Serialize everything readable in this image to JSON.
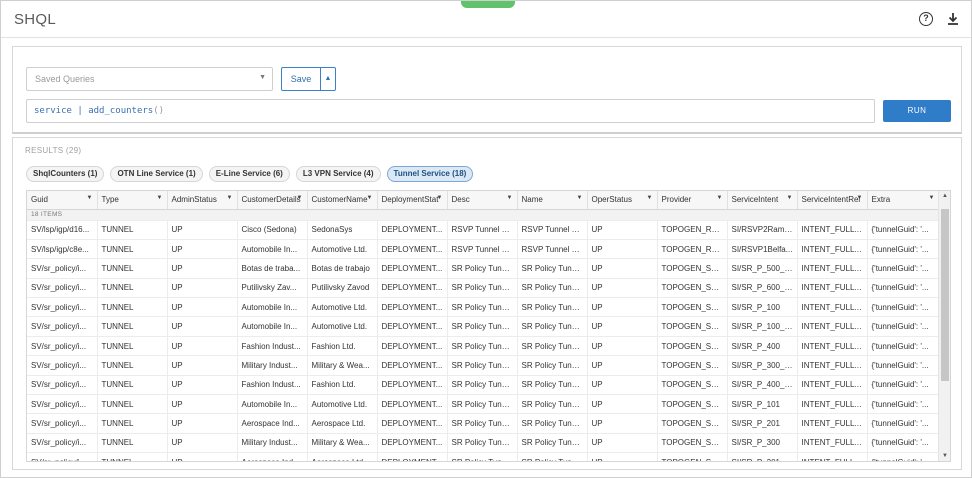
{
  "header": {
    "title": "SHQL"
  },
  "query": {
    "saved_placeholder": "Saved Queries",
    "save_label": "Save",
    "keyword": "service",
    "pipe": "|",
    "func": "add_counters",
    "parens": "()",
    "run_label": "RUN"
  },
  "results": {
    "label": "RESULTS (29)",
    "count_label": "18 ITEMS",
    "tabs": [
      {
        "label": "ShqlCounters (1)"
      },
      {
        "label": "OTN Line Service (1)"
      },
      {
        "label": "E-Line Service (6)"
      },
      {
        "label": "L3 VPN Service (4)"
      },
      {
        "label": "Tunnel Service (18)"
      }
    ],
    "columns": [
      "Guid",
      "Type",
      "AdminStatus",
      "CustomerDetails",
      "CustomerName",
      "DeploymentStat",
      "Desc",
      "Name",
      "OperStatus",
      "Provider",
      "ServiceIntent",
      "ServiceIntentRel",
      "Extra"
    ],
    "rows": [
      [
        "SV/lsp/igp/d16...",
        "TUNNEL",
        "UP",
        "Cisco (Sedona)",
        "SedonaSys",
        "DEPLOYMENT...",
        "RSVP Tunnel <...",
        "RSVP Tunnel <...",
        "UP",
        "TOPOGEN_RS...",
        "SI/RSVP2Rama...",
        "INTENT_FULLY...",
        "{'tunnelGuid': '..."
      ],
      [
        "SV/lsp/igp/c8e...",
        "TUNNEL",
        "UP",
        "Automobile In...",
        "Automotive Ltd.",
        "DEPLOYMENT...",
        "RSVP Tunnel <...",
        "RSVP Tunnel <...",
        "UP",
        "TOPOGEN_RS...",
        "SI/RSVP1Belfa...",
        "INTENT_FULLY...",
        "{'tunnelGuid': '..."
      ],
      [
        "SV/sr_policy/i...",
        "TUNNEL",
        "UP",
        "Botas de traba...",
        "Botas de trabajo",
        "DEPLOYMENT...",
        "SR Policy Tunn...",
        "SR Policy Tunn...",
        "UP",
        "TOPOGEN_SR...",
        "SI/SR_P_500_r...",
        "INTENT_FULLY...",
        "{'tunnelGuid': '..."
      ],
      [
        "SV/sr_policy/i...",
        "TUNNEL",
        "UP",
        "Putilivsky Zav...",
        "Putilivsky Zavod",
        "DEPLOYMENT...",
        "SR Policy Tunn...",
        "SR Policy Tunn...",
        "UP",
        "TOPOGEN_SR...",
        "SI/SR_P_600_r...",
        "INTENT_FULLY...",
        "{'tunnelGuid': '..."
      ],
      [
        "SV/sr_policy/i...",
        "TUNNEL",
        "UP",
        "Automobile In...",
        "Automotive Ltd.",
        "DEPLOYMENT...",
        "SR Policy Tunn...",
        "SR Policy Tunn...",
        "UP",
        "TOPOGEN_SR...",
        "SI/SR_P_100",
        "INTENT_FULLY...",
        "{'tunnelGuid': '..."
      ],
      [
        "SV/sr_policy/i...",
        "TUNNEL",
        "UP",
        "Automobile In...",
        "Automotive Ltd.",
        "DEPLOYMENT...",
        "SR Policy Tunn...",
        "SR Policy Tunn...",
        "UP",
        "TOPOGEN_SR...",
        "SI/SR_P_100_r...",
        "INTENT_FULLY...",
        "{'tunnelGuid': '..."
      ],
      [
        "SV/sr_policy/i...",
        "TUNNEL",
        "UP",
        "Fashion Indust...",
        "Fashion Ltd.",
        "DEPLOYMENT...",
        "SR Policy Tunn...",
        "SR Policy Tunn...",
        "UP",
        "TOPOGEN_SR...",
        "SI/SR_P_400",
        "INTENT_FULLY...",
        "{'tunnelGuid': '..."
      ],
      [
        "SV/sr_policy/i...",
        "TUNNEL",
        "UP",
        "Military Indust...",
        "Military & Wea...",
        "DEPLOYMENT...",
        "SR Policy Tunn...",
        "SR Policy Tunn...",
        "UP",
        "TOPOGEN_SR...",
        "SI/SR_P_300_r...",
        "INTENT_FULLY...",
        "{'tunnelGuid': '..."
      ],
      [
        "SV/sr_policy/i...",
        "TUNNEL",
        "UP",
        "Fashion Indust...",
        "Fashion Ltd.",
        "DEPLOYMENT...",
        "SR Policy Tunn...",
        "SR Policy Tunn...",
        "UP",
        "TOPOGEN_SR...",
        "SI/SR_P_400_r...",
        "INTENT_FULLY...",
        "{'tunnelGuid': '..."
      ],
      [
        "SV/sr_policy/i...",
        "TUNNEL",
        "UP",
        "Automobile In...",
        "Automotive Ltd.",
        "DEPLOYMENT...",
        "SR Policy Tunn...",
        "SR Policy Tunn...",
        "UP",
        "TOPOGEN_SR...",
        "SI/SR_P_101",
        "INTENT_FULLY...",
        "{'tunnelGuid': '..."
      ],
      [
        "SV/sr_policy/i...",
        "TUNNEL",
        "UP",
        "Aerospace Ind...",
        "Aerospace Ltd.",
        "DEPLOYMENT...",
        "SR Policy Tunn...",
        "SR Policy Tunn...",
        "UP",
        "TOPOGEN_SR...",
        "SI/SR_P_201",
        "INTENT_FULLY...",
        "{'tunnelGuid': '..."
      ],
      [
        "SV/sr_policy/i...",
        "TUNNEL",
        "UP",
        "Military Indust...",
        "Military & Wea...",
        "DEPLOYMENT...",
        "SR Policy Tunn...",
        "SR Policy Tunn...",
        "UP",
        "TOPOGEN_SR...",
        "SI/SR_P_300",
        "INTENT_FULLY...",
        "{'tunnelGuid': '..."
      ],
      [
        "SV/sr_policy/i...",
        "TUNNEL",
        "UP",
        "Aerospace Ind...",
        "Aerospace Ltd.",
        "DEPLOYMENT...",
        "SR Policy Tunn...",
        "SR Policy Tunn...",
        "UP",
        "TOPOGEN_SR...",
        "SI/SR_P_201_r...",
        "INTENT_FULLY...",
        "{'tunnelGuid': '..."
      ]
    ]
  },
  "icons": {
    "help": "help-icon",
    "download": "download-icon",
    "sort": "sort-caret-icon"
  },
  "colors": {
    "accent": "#2f7cc8",
    "active_tab_bg": "#dbe9f7",
    "top_tab": "#62c26b"
  }
}
